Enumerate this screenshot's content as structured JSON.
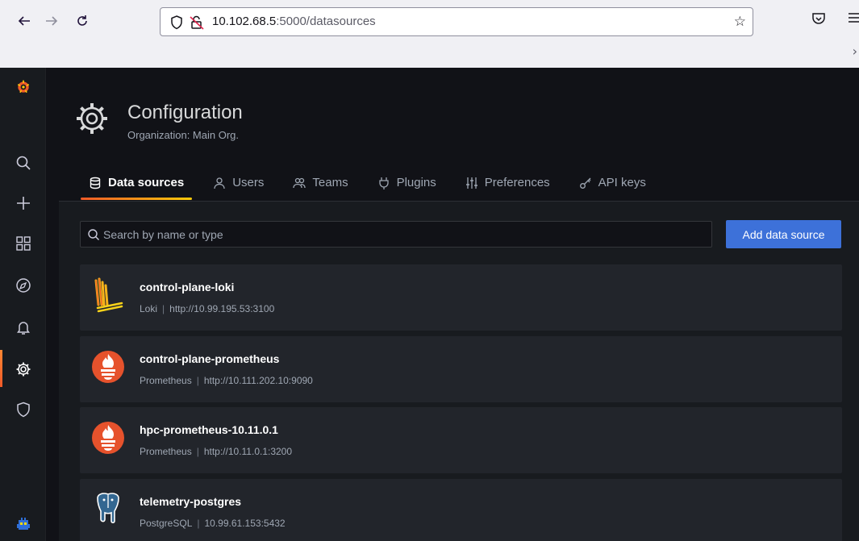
{
  "browser": {
    "back_icon": "arrow-left-icon",
    "forward_icon": "arrow-right-icon",
    "reload_icon": "reload-icon",
    "url_host": "10.102.68.5",
    "url_rest": ":5000/datasources"
  },
  "sidebar": {
    "items": [
      {
        "name": "grafana-logo"
      },
      {
        "name": "search"
      },
      {
        "name": "create"
      },
      {
        "name": "dashboards"
      },
      {
        "name": "explore"
      },
      {
        "name": "alerting"
      },
      {
        "name": "configuration"
      },
      {
        "name": "server-admin"
      },
      {
        "name": "profile"
      }
    ],
    "active": "configuration",
    "accent": "#f05a28"
  },
  "header": {
    "title": "Configuration",
    "subtitle": "Organization: Main Org."
  },
  "tabs": [
    {
      "label": "Data sources",
      "icon": "database-icon",
      "active": true
    },
    {
      "label": "Users",
      "icon": "user-icon",
      "active": false
    },
    {
      "label": "Teams",
      "icon": "users-icon",
      "active": false
    },
    {
      "label": "Plugins",
      "icon": "plug-icon",
      "active": false
    },
    {
      "label": "Preferences",
      "icon": "sliders-icon",
      "active": false
    },
    {
      "label": "API keys",
      "icon": "key-icon",
      "active": false
    }
  ],
  "search": {
    "placeholder": "Search by name or type"
  },
  "add_button": {
    "label": "Add data source",
    "color": "#3d71d9"
  },
  "datasources": [
    {
      "name": "control-plane-loki",
      "type": "Loki",
      "url": "http://10.99.195.53:3100",
      "logo": "loki-logo"
    },
    {
      "name": "control-plane-prometheus",
      "type": "Prometheus",
      "url": "http://10.111.202.10:9090",
      "logo": "prometheus-logo"
    },
    {
      "name": "hpc-prometheus-10.11.0.1",
      "type": "Prometheus",
      "url": "http://10.11.0.1:3200",
      "logo": "prometheus-logo"
    },
    {
      "name": "telemetry-postgres",
      "type": "PostgreSQL",
      "url": "10.99.61.153:5432",
      "logo": "postgresql-logo"
    }
  ]
}
